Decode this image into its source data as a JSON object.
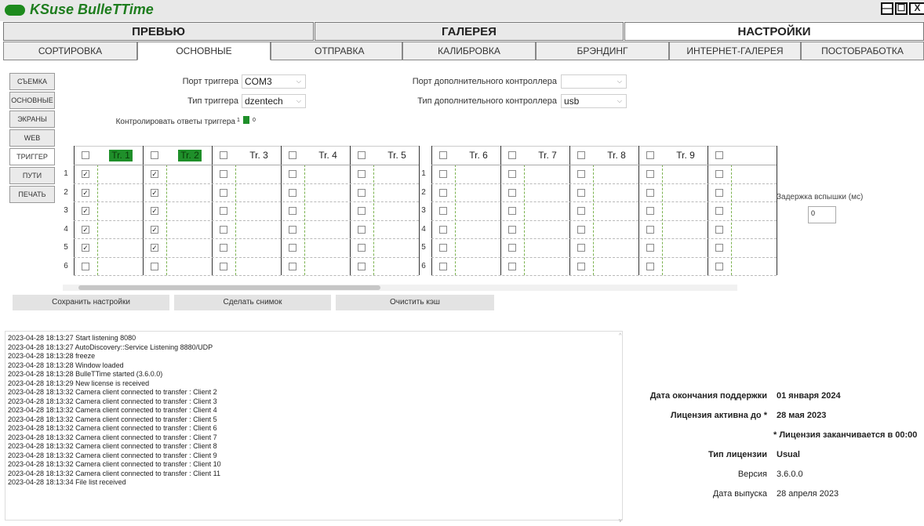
{
  "window": {
    "title": "KSuse BulleTTime",
    "minimize": "—",
    "maximize": "☐",
    "close": "X"
  },
  "main_tabs": [
    {
      "label": "ПРЕВЬЮ"
    },
    {
      "label": "ГАЛЕРЕЯ"
    },
    {
      "label": "НАСТРОЙКИ"
    }
  ],
  "sub_tabs": [
    {
      "label": "СОРТИРОВКА"
    },
    {
      "label": "ОСНОВНЫЕ"
    },
    {
      "label": "ОТПРАВКА"
    },
    {
      "label": "КАЛИБРОВКА"
    },
    {
      "label": "БРЭНДИНГ"
    },
    {
      "label": "ИНТЕРНЕТ-ГАЛЕРЕЯ"
    },
    {
      "label": "ПОСТОБРАБОТКА"
    }
  ],
  "side_nav": [
    {
      "label": "СЪЕМКА"
    },
    {
      "label": "ОСНОВНЫЕ"
    },
    {
      "label": "ЭКРАНЫ"
    },
    {
      "label": "WEB"
    },
    {
      "label": "ТРИГГЕР"
    },
    {
      "label": "ПУТИ"
    },
    {
      "label": "ПЕЧАТЬ"
    }
  ],
  "trigger": {
    "port_label": "Порт триггера",
    "port_value": "COM3",
    "type_label": "Тип триггера",
    "type_value": "dzentech",
    "control_label": "Контролировать ответы триггера",
    "control_on": "1",
    "control_off": "0",
    "aux_port_label": "Порт дополнительного контроллера",
    "aux_port_value": "",
    "aux_type_label": "Тип дополнительного контроллера",
    "aux_type_value": "usb"
  },
  "table": {
    "left_headers": [
      "Tr. 1",
      "Tr. 2",
      "Tr. 3",
      "Tr. 4",
      "Tr. 5"
    ],
    "right_headers": [
      "Tr. 6",
      "Tr. 7",
      "Tr. 8",
      "Tr. 9",
      ""
    ],
    "row_numbers": [
      "1",
      "2",
      "3",
      "4",
      "5",
      "6"
    ],
    "checked_columns": [
      0,
      1
    ],
    "checked_rows": 5,
    "check_mark": "✓",
    "highlight_color": "#1f8f2a"
  },
  "flash_delay": {
    "label": "Задержка вспышки (мс)",
    "value": "0"
  },
  "actions": {
    "save": "Сохранить настройки",
    "snapshot": "Сделать снимок",
    "clear_cache": "Очистить кэш"
  },
  "log": [
    "2023-04-28 18:13:27 Start listening 8080",
    "2023-04-28 18:13:27 AutoDiscovery::Service Listening 8880/UDP",
    "2023-04-28 18:13:28 freeze",
    "2023-04-28 18:13:28 Window loaded",
    "2023-04-28 18:13:28 BulleTTime started (3.6.0.0)",
    "2023-04-28 18:13:29 New license is received",
    "2023-04-28 18:13:32 Camera client connected to transfer : Client 2",
    "2023-04-28 18:13:32 Camera client connected to transfer : Client 3",
    "2023-04-28 18:13:32 Camera client connected to transfer : Client 4",
    "2023-04-28 18:13:32 Camera client connected to transfer : Client 5",
    "2023-04-28 18:13:32 Camera client connected to transfer : Client 6",
    "2023-04-28 18:13:32 Camera client connected to transfer : Client 7",
    "2023-04-28 18:13:32 Camera client connected to transfer : Client 8",
    "2023-04-28 18:13:32 Camera client connected to transfer : Client 9",
    "2023-04-28 18:13:32 Camera client connected to transfer : Client 10",
    "2023-04-28 18:13:32 Camera client connected to transfer : Client 11",
    "2023-04-28 18:13:34 File list received"
  ],
  "license": {
    "support_end_label": "Дата окончания поддержки",
    "support_end_value": "01 января 2024",
    "active_until_label": "Лицензия активна до *",
    "active_until_value": "28 мая 2023",
    "note": "* Лицензия заканчивается в 00:00",
    "type_label": "Тип лицензии",
    "type_value": "Usual",
    "version_label": "Версия",
    "version_value": "3.6.0.0",
    "release_label": "Дата выпуска",
    "release_value": "28 апреля 2023"
  }
}
